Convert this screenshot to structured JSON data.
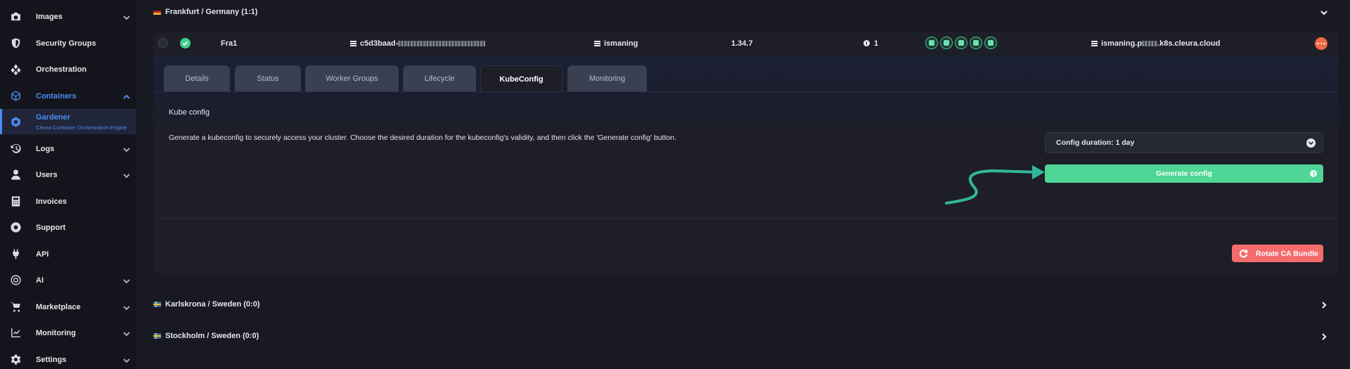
{
  "sidebar": {
    "items": [
      {
        "label": "Images",
        "icon": "camera-icon"
      },
      {
        "label": "Security Groups",
        "icon": "shield-icon"
      },
      {
        "label": "Orchestration",
        "icon": "layers-icon"
      },
      {
        "label": "Containers",
        "icon": "cube-icon"
      },
      {
        "label": "Gardener",
        "sublabel": "Cleura Container Orchestration Engine",
        "icon": "gear-hex-icon"
      },
      {
        "label": "Logs",
        "icon": "history-icon"
      },
      {
        "label": "Users",
        "icon": "user-icon"
      },
      {
        "label": "Invoices",
        "icon": "calculator-icon"
      },
      {
        "label": "Support",
        "icon": "lifebuoy-icon"
      },
      {
        "label": "API",
        "icon": "plug-icon"
      },
      {
        "label": "AI",
        "icon": "ai-icon"
      },
      {
        "label": "Marketplace",
        "icon": "cart-icon"
      },
      {
        "label": "Monitoring",
        "icon": "chart-icon"
      },
      {
        "label": "Settings",
        "icon": "settings-icon"
      }
    ]
  },
  "regions": {
    "frankfurt": "Frankfurt / Germany (1:1)",
    "karlskrona": "Karlskrona / Sweden (0:0)",
    "stockholm": "Stockholm / Sweden (0:0)"
  },
  "cluster": {
    "name": "Fra1",
    "id_prefix": "c5d3baad-",
    "project": "ismaning",
    "version": "1.34.7",
    "nodes": "1",
    "domain_prefix": "ismaning.p",
    "domain_suffix": ".k8s.cleura.cloud"
  },
  "tabs": [
    "Details",
    "Status",
    "Worker Groups",
    "Lifecycle",
    "KubeConfig",
    "Monitoring"
  ],
  "kubeconfig": {
    "title": "Kube config",
    "description": "Generate a kubeconfig to securely access your cluster. Choose the desired duration for the kubeconfig's validity, and then click the 'Generate config' button.",
    "duration_label": "Config duration: 1 day",
    "generate_label": "Generate config",
    "rotate_label": "Rotate CA Bundle"
  },
  "colors": {
    "accent": "#4c8cf0",
    "success": "#4fd596",
    "danger": "#f46c6c",
    "arrow": "#2fb99a"
  }
}
